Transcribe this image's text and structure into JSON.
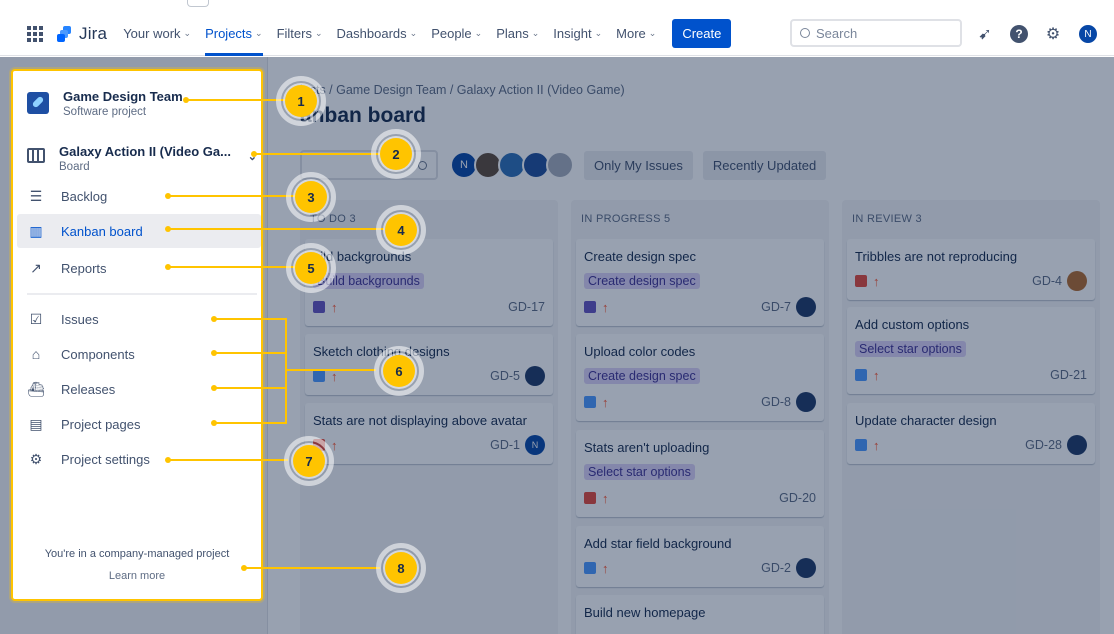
{
  "topnav": {
    "brand": "Jira",
    "items": [
      {
        "label": "Your work",
        "active": false
      },
      {
        "label": "Projects",
        "active": true
      },
      {
        "label": "Filters",
        "active": false
      },
      {
        "label": "Dashboards",
        "active": false
      },
      {
        "label": "People",
        "active": false
      },
      {
        "label": "Plans",
        "active": false
      },
      {
        "label": "Insight",
        "active": false
      },
      {
        "label": "More",
        "active": false
      }
    ],
    "create_label": "Create",
    "search_placeholder": "Search",
    "user_initial": "N"
  },
  "sidebar": {
    "project_name": "Game Design Team",
    "project_type": "Software project",
    "board_name": "Galaxy Action II (Video Ga...",
    "board_type": "Board",
    "items": [
      {
        "label": "Backlog",
        "icon": "backlog-icon"
      },
      {
        "label": "Kanban board",
        "icon": "board-icon",
        "selected": true
      },
      {
        "label": "Reports",
        "icon": "reports-icon"
      },
      {
        "label": "Issues",
        "icon": "issues-icon"
      },
      {
        "label": "Components",
        "icon": "components-icon"
      },
      {
        "label": "Releases",
        "icon": "releases-icon"
      },
      {
        "label": "Project pages",
        "icon": "pages-icon"
      },
      {
        "label": "Project settings",
        "icon": "gear-icon"
      }
    ],
    "footer_text": "You're in a company-managed project",
    "learn_more": "Learn more"
  },
  "board": {
    "breadcrumb": "jects  /  Game Design Team  /  Galaxy Action II (Video Game)",
    "title": "anban board",
    "filters": {
      "avatar_initial": "N",
      "only_my_issues": "Only My Issues",
      "recently_updated": "Recently Updated"
    },
    "columns": [
      {
        "header": "TO DO 3",
        "cards": [
          {
            "title": "uild backgrounds",
            "epic": "Build backgrounds",
            "type": "story",
            "key": "GD-17",
            "avatar": ""
          },
          {
            "title": "Sketch clothing designs",
            "epic": "",
            "type": "task",
            "key": "GD-5",
            "avatar": "dark"
          },
          {
            "title": "Stats are not displaying above avatar",
            "epic": "",
            "type": "bug",
            "key": "GD-1",
            "avatar": "N"
          }
        ]
      },
      {
        "header": "IN PROGRESS 5",
        "cards": [
          {
            "title": "Create design spec",
            "epic": "Create design spec",
            "type": "story",
            "key": "GD-7",
            "avatar": "dark"
          },
          {
            "title": "Upload color codes",
            "epic": "Create design spec",
            "type": "task",
            "key": "GD-8",
            "avatar": "dark"
          },
          {
            "title": "Stats aren't uploading",
            "epic": "Select star options",
            "type": "bug",
            "key": "GD-20",
            "avatar": ""
          },
          {
            "title": "Add star field background",
            "epic": "",
            "type": "task",
            "key": "GD-2",
            "avatar": "dark"
          },
          {
            "title": "Build new homepage",
            "epic": "",
            "type": "",
            "key": "",
            "avatar": ""
          }
        ]
      },
      {
        "header": "IN REVIEW 3",
        "cards": [
          {
            "title": "Tribbles are not reproducing",
            "epic": "",
            "type": "bug",
            "key": "GD-4",
            "avatar": "warm"
          },
          {
            "title": "Add custom options",
            "epic": "Select star options",
            "type": "task",
            "key": "GD-21",
            "avatar": ""
          },
          {
            "title": "Update character design",
            "epic": "",
            "type": "task",
            "key": "GD-28",
            "avatar": "dark"
          }
        ]
      }
    ]
  },
  "callouts": [
    "1",
    "2",
    "3",
    "4",
    "5",
    "6",
    "7",
    "8"
  ],
  "colors": {
    "accent": "#0052cc",
    "highlight": "#ffc400",
    "epic_bg": "#dcd3f7",
    "story": "#6554c0",
    "task": "#4c9aff",
    "bug": "#e5493a"
  }
}
